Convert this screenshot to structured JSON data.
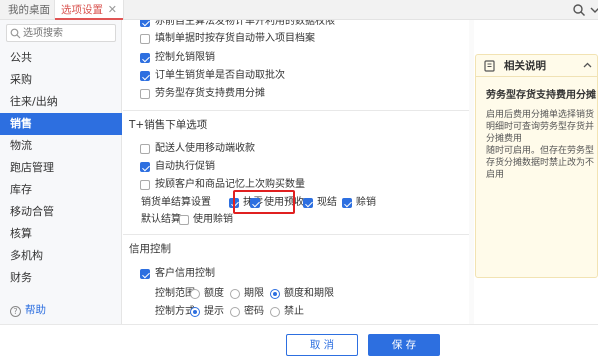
{
  "tabs": {
    "home": "我的桌面",
    "active": "选项设置"
  },
  "sidebar": {
    "search_placeholder": "选项搜索",
    "items": [
      "公共",
      "采购",
      "往来/出纳",
      "销售",
      "物流",
      "跑店管理",
      "库存",
      "移动合管",
      "核算",
      "多机构",
      "财务"
    ],
    "active_index": 3,
    "help": "帮助"
  },
  "main": {
    "top_options": [
      {
        "label": "赤前自主算法发物计单开利用的数据权限",
        "checked": true
      },
      {
        "label": "填制单据时按存货自动带入项目档案",
        "checked": false
      },
      {
        "label": "控制允销限销",
        "checked": true
      },
      {
        "label": "订单生销货单是否自动取批次",
        "checked": true
      },
      {
        "label": "劳务型存货支持费用分摊",
        "checked": false
      }
    ],
    "section_t": "T+销售下单选项",
    "t_options": [
      {
        "label": "配送人使用移动端收款",
        "checked": false
      },
      {
        "label": "自动执行促销",
        "checked": true
      },
      {
        "label": "按顾客户和商品记忆上次购买数量",
        "checked": false
      }
    ],
    "settle_label": "销货单结算设置",
    "settle_options": [
      {
        "label": "抹零",
        "checked": true
      },
      {
        "label": "使用预收",
        "checked": true
      },
      {
        "label": "现结",
        "checked": true
      },
      {
        "label": "赊销",
        "checked": true
      }
    ],
    "default_settle_label": "默认结算",
    "default_settle_option": {
      "label": "使用赊销",
      "checked": false
    },
    "section_credit": "信用控制",
    "credit_enable": {
      "label": "客户信用控制",
      "checked": true
    },
    "credit_range_label": "控制范围",
    "credit_range_options": [
      {
        "label": "额度",
        "selected": false
      },
      {
        "label": "期限",
        "selected": false
      },
      {
        "label": "额度和期限",
        "selected": true
      }
    ],
    "credit_mode_label": "控制方式",
    "credit_mode_options": [
      {
        "label": "提示",
        "selected": true
      },
      {
        "label": "密码",
        "selected": false
      },
      {
        "label": "禁止",
        "selected": false
      }
    ]
  },
  "info_panel": {
    "title": "相关说明",
    "subtitle": "劳务型存货支持费用分摊",
    "body": "启用后费用分摊单选择销货明细时可查询劳务型存货并分摊费用\n随时可启用。但存在劳务型存货分摊数据时禁止改为不启用"
  },
  "footer": {
    "cancel": "取 消",
    "save": "保 存"
  },
  "colors": {
    "primary": "#2d6fe0",
    "highlight_box": "#e02020",
    "active_tab_text": "#d9534f",
    "info_bg": "#fffbea"
  }
}
